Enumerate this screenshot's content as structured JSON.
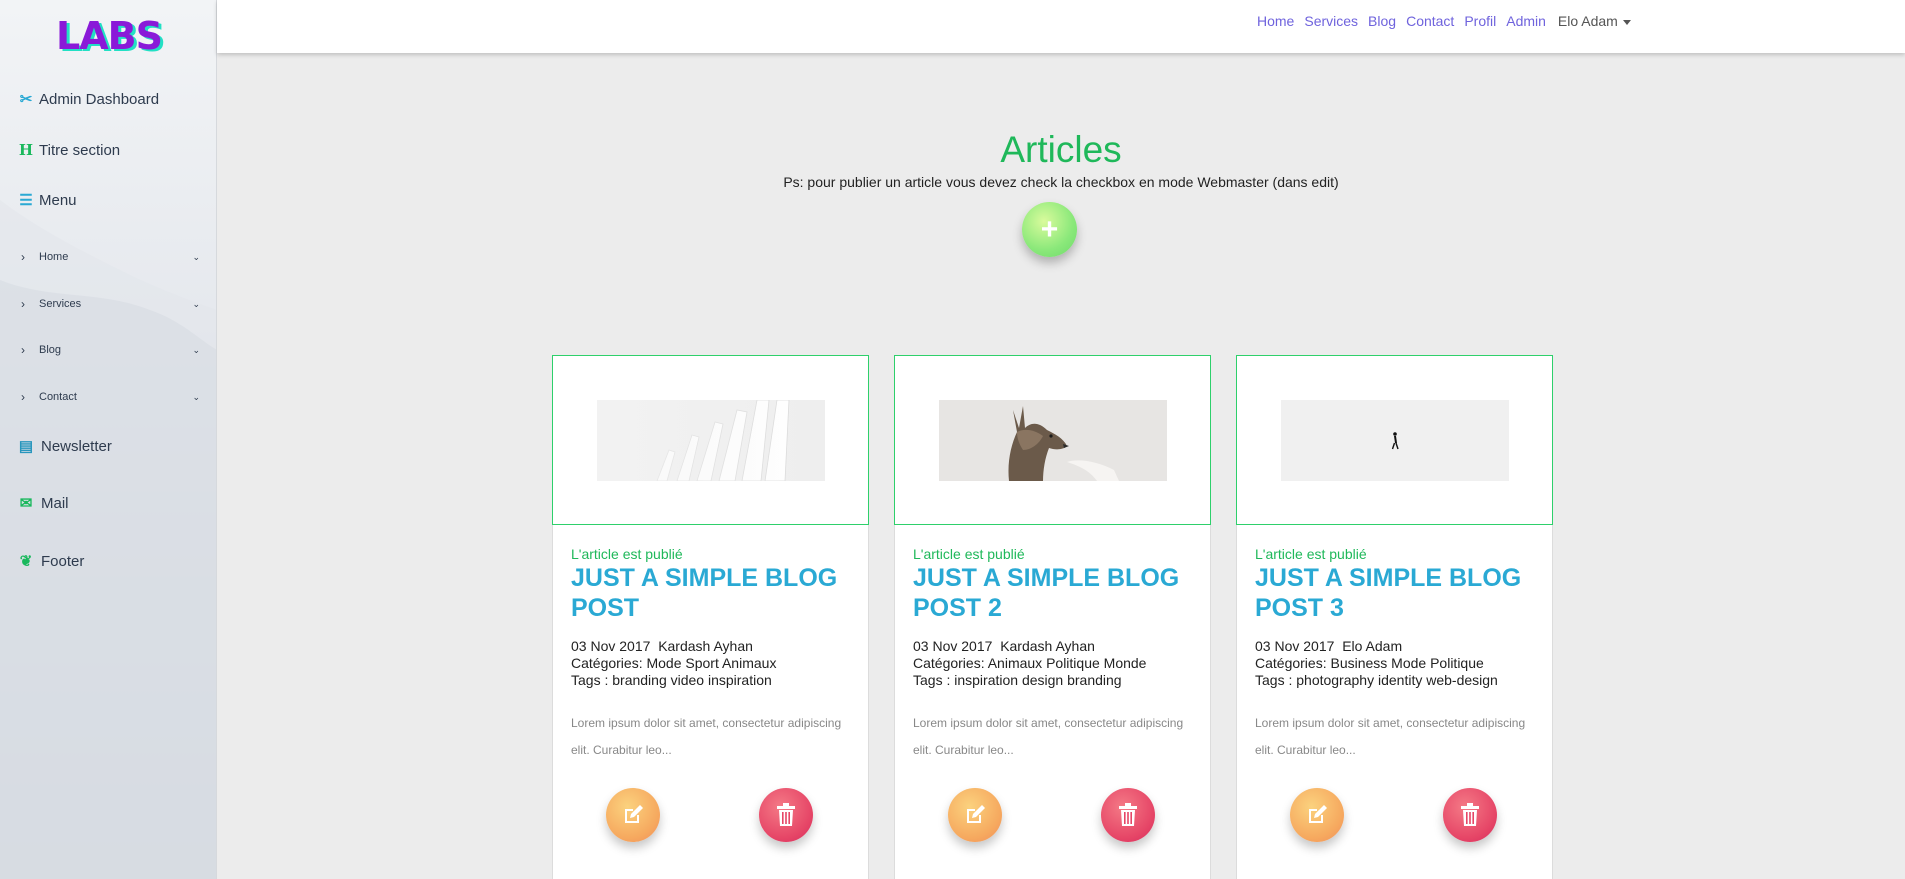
{
  "sidebar": {
    "logo": "LABS",
    "items": [
      {
        "label": "Admin Dashboard",
        "icon": "tools-icon"
      },
      {
        "label": "Titre section",
        "icon": "heading-icon"
      },
      {
        "label": "Menu",
        "icon": "bars-icon"
      },
      {
        "label": "Home",
        "icon": "chevron-right-icon"
      },
      {
        "label": "Services",
        "icon": "chevron-right-icon"
      },
      {
        "label": "Blog",
        "icon": "chevron-right-icon"
      },
      {
        "label": "Contact",
        "icon": "chevron-right-icon"
      },
      {
        "label": "Newsletter",
        "icon": "mail-bulk-icon"
      },
      {
        "label": "Mail",
        "icon": "envelope-icon"
      },
      {
        "label": "Footer",
        "icon": "shoe-prints-icon"
      }
    ]
  },
  "navbar": {
    "links": [
      "Home",
      "Services",
      "Blog",
      "Contact",
      "Profil",
      "Admin"
    ],
    "user": "Elo Adam"
  },
  "main": {
    "title": "Articles",
    "subtitle": "Ps: pour publier un article vous devez check la checkbox en mode Webmaster (dans edit)",
    "add_icon": "plus-icon"
  },
  "articles": [
    {
      "status": "L'article est publié",
      "title": "JUST A SIMPLE BLOG POST",
      "date": "03 Nov 2017",
      "author": "Kardash Ayhan",
      "categories": "Catégories: Mode Sport Animaux",
      "tags": "Tags : branding video inspiration",
      "excerpt": "Lorem ipsum dolor sit amet, consectetur adipiscing elit. Curabitur leo...",
      "image": "white-architecture-image"
    },
    {
      "status": "L'article est publié",
      "title": "JUST A SIMPLE BLOG POST 2",
      "date": "03 Nov 2017",
      "author": "Kardash Ayhan",
      "categories": "Catégories: Animaux Politique Monde",
      "tags": "Tags : inspiration design branding",
      "excerpt": "Lorem ipsum dolor sit amet, consectetur adipiscing elit. Curabitur leo...",
      "image": "deer-image"
    },
    {
      "status": "L'article est publié",
      "title": "JUST A SIMPLE BLOG POST 3",
      "date": "03 Nov 2017",
      "author": "Elo Adam",
      "categories": "Catégories: Business Mode Politique",
      "tags": "Tags : photography identity web-design",
      "excerpt": "Lorem ipsum dolor sit amet, consectetur adipiscing elit. Curabitur leo...",
      "image": "person-in-snow-image"
    }
  ],
  "colors": {
    "accent_green": "#1fb85a",
    "title_blue": "#2aa9d4",
    "nav_purple": "#6f63dd",
    "edit_orange": "#f6a95f",
    "delete_red": "#e64667"
  }
}
